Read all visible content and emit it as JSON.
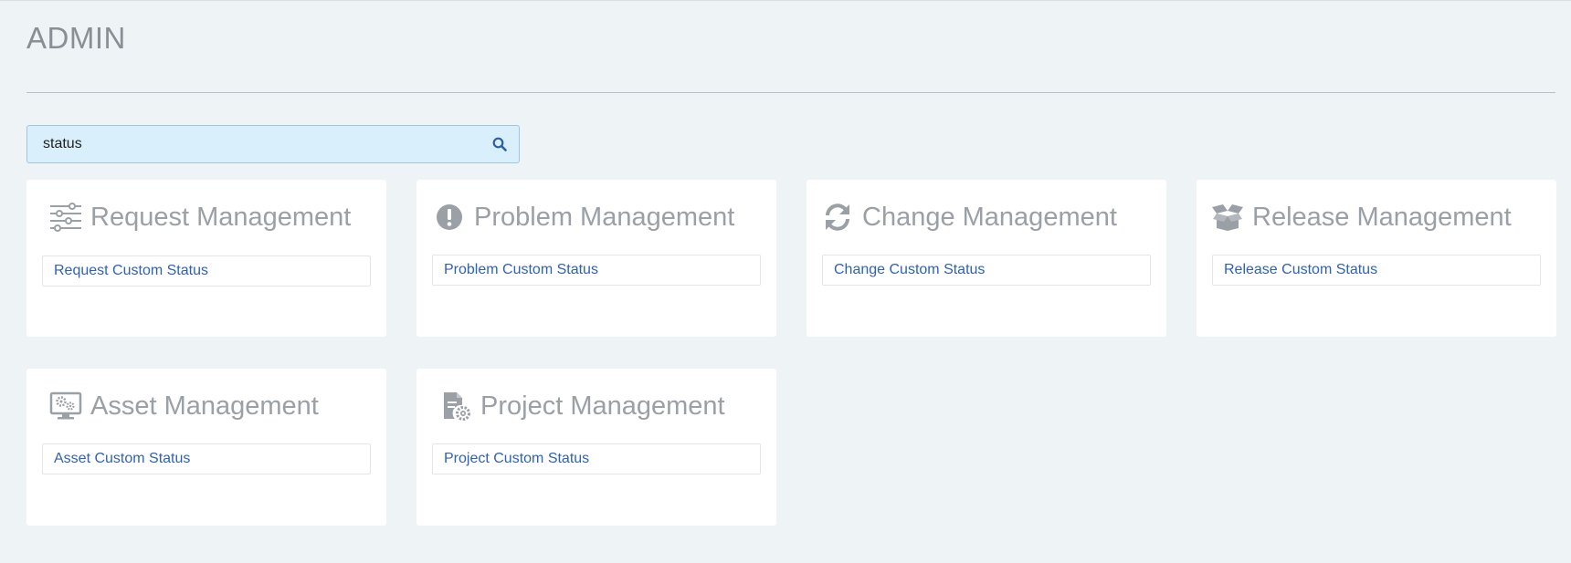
{
  "page": {
    "title": "ADMIN"
  },
  "search": {
    "value": "status",
    "icon": "search-icon"
  },
  "colors": {
    "background": "#eef3f6",
    "search_bg": "#d9f0fc",
    "link": "#2f62b5",
    "title": "#9aa0a6"
  },
  "cards": [
    {
      "title": "Request Management",
      "icon": "sliders-icon",
      "link": "Request Custom Status"
    },
    {
      "title": "Problem Management",
      "icon": "exclamation-circle-icon",
      "link": "Problem Custom Status"
    },
    {
      "title": "Change Management",
      "icon": "refresh-icon",
      "link": "Change Custom Status"
    },
    {
      "title": "Release Management",
      "icon": "open-box-icon",
      "link": "Release Custom Status"
    },
    {
      "title": "Asset Management",
      "icon": "monitor-gears-icon",
      "link": "Asset Custom Status"
    },
    {
      "title": "Project Management",
      "icon": "document-gear-icon",
      "link": "Project Custom Status"
    }
  ]
}
